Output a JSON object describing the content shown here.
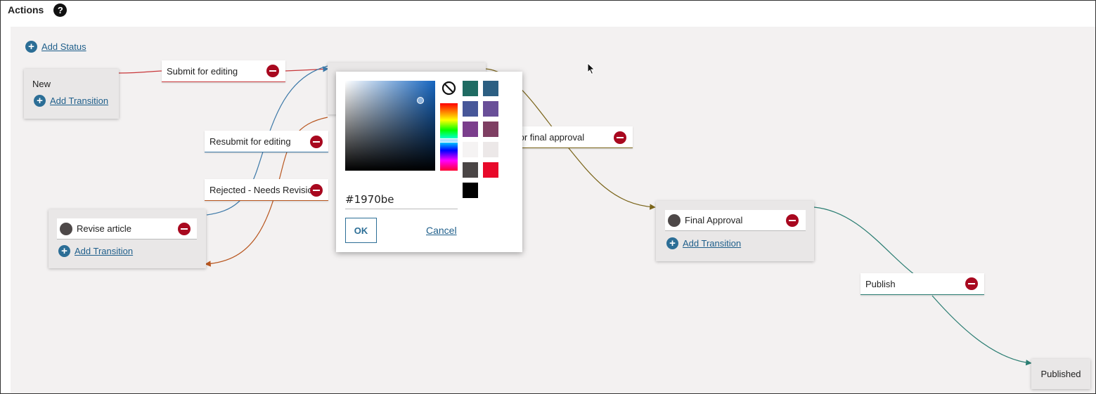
{
  "header": {
    "title": "Actions",
    "help_glyph": "?"
  },
  "canvas": {
    "add_status_label": "Add Status",
    "add_transition_label": "Add Transition"
  },
  "statuses": {
    "new": "New",
    "revise": "Revise article",
    "final_approval": "Final Approval",
    "published": "Published"
  },
  "transitions": {
    "submit": "Submit for editing",
    "resubmit": "Resubmit for editing",
    "rejected": "Rejected - Needs Revision",
    "final": "Send for final approval",
    "publish": "Publish"
  },
  "color_picker": {
    "hex_value": "#1970be",
    "ok_label": "OK",
    "cancel_label": "Cancel",
    "swatches": [
      "#1f6b62",
      "#2c5f82",
      "#475799",
      "#694f98",
      "#7b3e8c",
      "#7f3f63",
      "#f5f3f3",
      "#ece8e8",
      "#4a4545",
      "#e8092a",
      "#000000"
    ]
  },
  "colors": {
    "edge_submit": "#c8373a",
    "edge_resubmit": "#3d79a8",
    "edge_rejected": "#b8561f",
    "edge_final": "#7a6419",
    "edge_publish": "#2a7d72",
    "accent": "#2c6e96",
    "remove": "#a8081f"
  }
}
